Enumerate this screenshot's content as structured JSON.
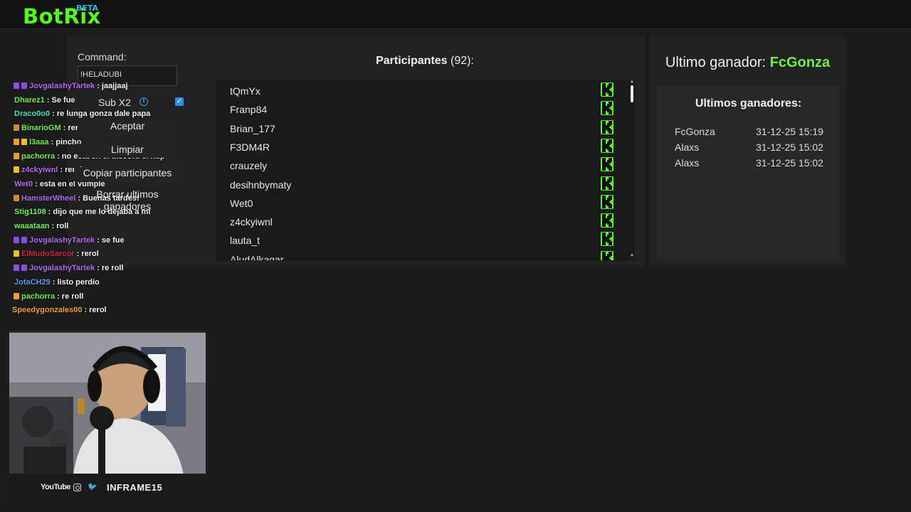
{
  "app": {
    "logo": "BotRix",
    "beta": "BETA"
  },
  "controls": {
    "command_label": "Command:",
    "command_value": "!HELADUBI",
    "sub_label": "Sub X2",
    "sub_checked": true,
    "accept_label": "Aceptar",
    "clear_label": "Limpiar",
    "copy_label": "Copiar participantes",
    "delete_label": "Borrar ultimos ganadores"
  },
  "participants": {
    "title": "Participantes",
    "count": "(92):",
    "items": [
      "tQmYx",
      "Franp84",
      "Brian_177",
      "F3DM4R",
      "crauzely",
      "desihnbymaty",
      "Wet0",
      "z4ckyiwnl",
      "lauta_t",
      "AludAlkagar"
    ]
  },
  "winner": {
    "label": "Ultimo ganador:",
    "name": "FcGonza",
    "list_title": "Ultimos ganadores:",
    "list": [
      {
        "name": "FcGonza",
        "time": "31-12-25 15:19"
      },
      {
        "name": "Alaxs",
        "time": "31-12-25 15:02"
      },
      {
        "name": "Alaxs",
        "time": "31-12-25 15:02"
      }
    ]
  },
  "chat": [
    {
      "user": "JovgalashyTartek",
      "msg": ": jaajjaaj",
      "color": "#b36bf0",
      "badges": [
        "#8a4fd8",
        "#8a4fd8"
      ]
    },
    {
      "user": "Dharez1",
      "msg": ": Se fue",
      "color": "#6ef04a",
      "badges": []
    },
    {
      "user": "Draco0o0",
      "msg": ": re lunga gonza dale papa",
      "color": "#3be8a8",
      "badges": []
    },
    {
      "user": "BinarioGM",
      "msg": ": reroll",
      "color": "#6ef04a",
      "badges": [
        "#d08a3a"
      ]
    },
    {
      "user": "l3aaa",
      "msg": ": pincho",
      "color": "#6ef04a",
      "badges": [
        "#f0a020",
        "#f0c020"
      ]
    },
    {
      "user": "pachorra",
      "msg": ": no está en el discord el hdp",
      "color": "#6ef04a",
      "badges": [
        "#f0a020"
      ]
    },
    {
      "user": "z4ckyiwnl",
      "msg": ": rerol",
      "color": "#b36bf0",
      "badges": [
        "#f0c020"
      ]
    },
    {
      "user": "Wet0",
      "msg": ": esta en el vumple",
      "color": "#b36bf0",
      "badges": []
    },
    {
      "user": "HamsterWheel",
      "msg": ": Buenas tardes!",
      "color": "#b36bf0",
      "badges": [
        "#d08a3a"
      ]
    },
    {
      "user": "Stig1108",
      "msg": ": dijo que me lo dejaba a mi",
      "color": "#6ef04a",
      "badges": []
    },
    {
      "user": "waaataan",
      "msg": ": roll",
      "color": "#6ef04a",
      "badges": []
    },
    {
      "user": "JovgalashyTartek",
      "msg": ": se fue",
      "color": "#b36bf0",
      "badges": [
        "#8a4fd8",
        "#8a4fd8"
      ]
    },
    {
      "user": "ElMudoSarcor",
      "msg": ": rerol",
      "color": "#d0243a",
      "badges": [
        "#f0c020"
      ]
    },
    {
      "user": "JovgalashyTartek",
      "msg": ": re roll",
      "color": "#b36bf0",
      "badges": [
        "#8a4fd8",
        "#8a4fd8"
      ]
    },
    {
      "user": "JotaCH29",
      "msg": ": listo perdio",
      "color": "#5b9cf0",
      "badges": []
    },
    {
      "user": "pachorra",
      "msg": ": re roll",
      "color": "#6ef04a",
      "badges": [
        "#f0a020"
      ]
    },
    {
      "user": "Speedygonzales00",
      "msg": ": rerol",
      "color": "#f0a020",
      "badges": []
    }
  ],
  "stream": {
    "youtube": "YouTube",
    "handle": "INFRAME15"
  }
}
